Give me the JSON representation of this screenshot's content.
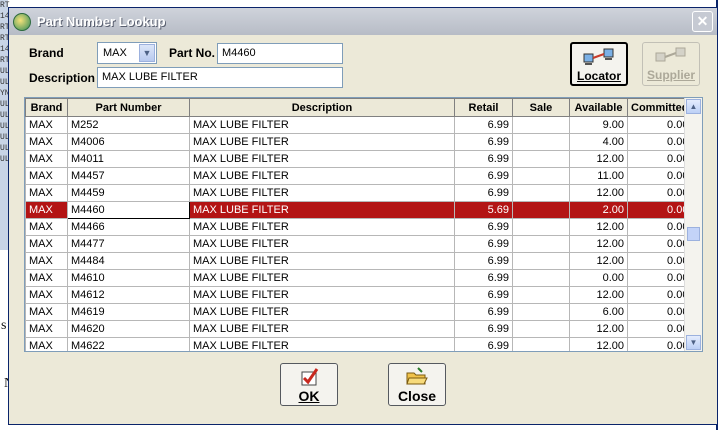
{
  "window": {
    "title": "Part Number Lookup",
    "close_glyph": "✕"
  },
  "form": {
    "brand_label": "Brand",
    "brand_value": "MAX",
    "partno_label": "Part No.",
    "partno_value": "M4460",
    "description_label": "Description",
    "description_value": "MAX LUBE FILTER"
  },
  "toolbar": {
    "locator_label": "Locator",
    "supplier_label": "Supplier"
  },
  "grid": {
    "columns": [
      "Brand",
      "Part Number",
      "Description",
      "Retail",
      "Sale",
      "Available",
      "Committed"
    ],
    "rows": [
      [
        "MAX",
        "M252",
        "MAX LUBE FILTER",
        "6.99",
        "",
        "9.00",
        "0.00"
      ],
      [
        "MAX",
        "M4006",
        "MAX LUBE FILTER",
        "6.99",
        "",
        "4.00",
        "0.00"
      ],
      [
        "MAX",
        "M4011",
        "MAX LUBE FILTER",
        "6.99",
        "",
        "12.00",
        "0.00"
      ],
      [
        "MAX",
        "M4457",
        "MAX LUBE FILTER",
        "6.99",
        "",
        "11.00",
        "0.00"
      ],
      [
        "MAX",
        "M4459",
        "MAX LUBE FILTER",
        "6.99",
        "",
        "12.00",
        "0.00"
      ],
      [
        "MAX",
        "M4460",
        "MAX LUBE FILTER",
        "5.69",
        "",
        "2.00",
        "0.00"
      ],
      [
        "MAX",
        "M4466",
        "MAX LUBE FILTER",
        "6.99",
        "",
        "12.00",
        "0.00"
      ],
      [
        "MAX",
        "M4477",
        "MAX LUBE FILTER",
        "6.99",
        "",
        "12.00",
        "0.00"
      ],
      [
        "MAX",
        "M4484",
        "MAX LUBE FILTER",
        "6.99",
        "",
        "12.00",
        "0.00"
      ],
      [
        "MAX",
        "M4610",
        "MAX LUBE FILTER",
        "6.99",
        "",
        "0.00",
        "0.00"
      ],
      [
        "MAX",
        "M4612",
        "MAX LUBE FILTER",
        "6.99",
        "",
        "12.00",
        "0.00"
      ],
      [
        "MAX",
        "M4619",
        "MAX LUBE FILTER",
        "6.99",
        "",
        "6.00",
        "0.00"
      ],
      [
        "MAX",
        "M4620",
        "MAX LUBE FILTER",
        "6.99",
        "",
        "12.00",
        "0.00"
      ],
      [
        "MAX",
        "M4622",
        "MAX LUBE FILTER",
        "6.99",
        "",
        "12.00",
        "0.00"
      ]
    ],
    "selected_row": 5,
    "selection_color": "#b31414"
  },
  "buttons": {
    "ok_label": "OK",
    "close_label": "Close"
  },
  "background": {
    "strip_text": [
      "RT",
      "14",
      "RT",
      "RT",
      "14",
      "RT",
      "ULI",
      "ULI",
      "YN",
      "ULI",
      "ULI",
      "ULI",
      "ULI",
      "ULI",
      "ULI"
    ],
    "fragment_1": "s",
    "fragment_2": "N"
  }
}
